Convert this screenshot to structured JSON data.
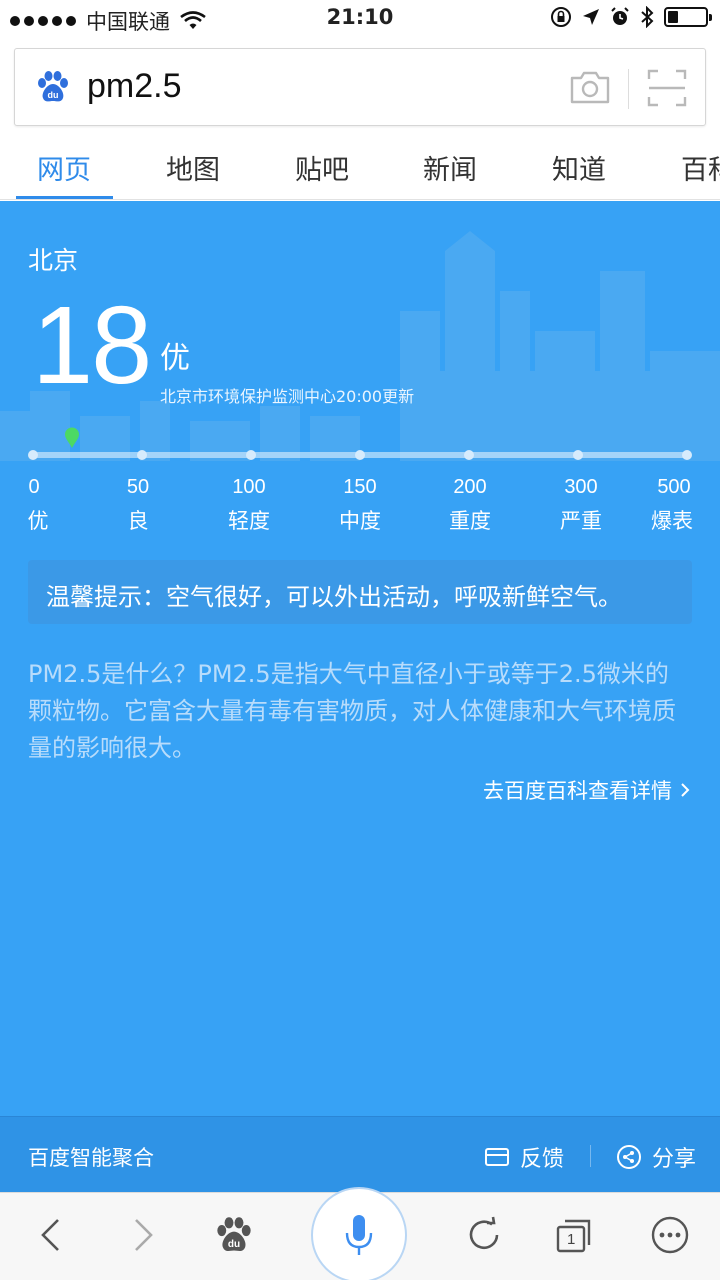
{
  "status_bar": {
    "carrier": "中国联通",
    "time": "21:10"
  },
  "search": {
    "query": "pm2.5"
  },
  "tabs": [
    {
      "label": "网页",
      "active": true
    },
    {
      "label": "地图",
      "active": false
    },
    {
      "label": "贴吧",
      "active": false
    },
    {
      "label": "新闻",
      "active": false
    },
    {
      "label": "知道",
      "active": false
    },
    {
      "label": "百科",
      "active": false
    }
  ],
  "air_quality": {
    "city": "北京",
    "value": "18",
    "level": "优",
    "source": "北京市环境保护监测中心20:00更新",
    "scale": [
      {
        "value": "0",
        "label": "优"
      },
      {
        "value": "50",
        "label": "良"
      },
      {
        "value": "100",
        "label": "轻度"
      },
      {
        "value": "150",
        "label": "中度"
      },
      {
        "value": "200",
        "label": "重度"
      },
      {
        "value": "300",
        "label": "严重"
      },
      {
        "value": "500",
        "label": "爆表"
      }
    ],
    "tip": "温馨提示：空气很好，可以外出活动，呼吸新鲜空气。",
    "description": "PM2.5是什么？PM2.5是指大气中直径小于或等于2.5微米的颗粒物。它富含大量有毒有害物质，对人体健康和大气环境质量的影响很大。",
    "more_link": "去百度百科查看详情"
  },
  "footer": {
    "brand": "百度智能聚合",
    "feedback": "反馈",
    "share": "分享"
  },
  "toolbar": {
    "tab_count": "1"
  },
  "colors": {
    "accent": "#2f8bea",
    "card_bg": "#37a2f5",
    "marker": "#4cd964"
  }
}
